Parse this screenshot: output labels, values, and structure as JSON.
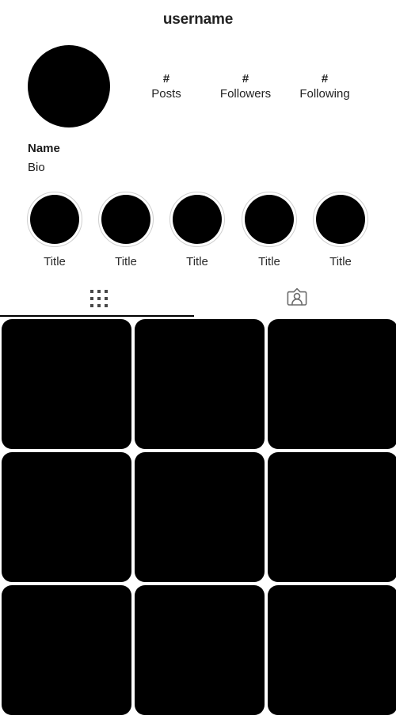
{
  "header": {
    "username": "username"
  },
  "profile": {
    "avatar_icon": "avatar-placeholder",
    "display_name": "Name",
    "bio": "Bio",
    "stats": [
      {
        "count": "#",
        "label": "Posts"
      },
      {
        "count": "#",
        "label": "Followers"
      },
      {
        "count": "#",
        "label": "Following"
      }
    ]
  },
  "highlights": [
    {
      "title": "Title"
    },
    {
      "title": "Title"
    },
    {
      "title": "Title"
    },
    {
      "title": "Title"
    },
    {
      "title": "Title"
    }
  ],
  "tabs": [
    {
      "name": "grid",
      "icon": "grid-icon",
      "active": true
    },
    {
      "name": "tagged",
      "icon": "tagged-person-icon",
      "active": false
    }
  ],
  "posts": [
    {
      "index": 1
    },
    {
      "index": 2
    },
    {
      "index": 3
    },
    {
      "index": 4
    },
    {
      "index": 5
    },
    {
      "index": 6
    },
    {
      "index": 7
    },
    {
      "index": 8
    },
    {
      "index": 9
    }
  ],
  "colors": {
    "background": "#ffffff",
    "text": "#1a1a1a",
    "placeholder_fill": "#000000",
    "ring": "#cfcfcf",
    "icon": "#484848",
    "active_underline": "#000000"
  }
}
